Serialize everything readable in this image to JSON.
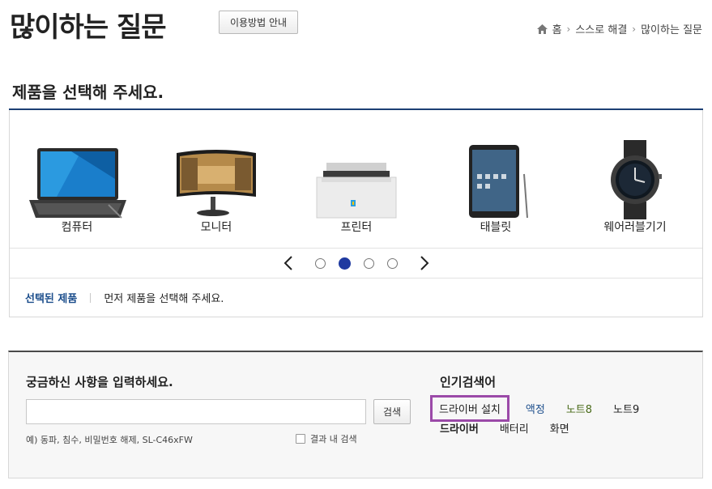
{
  "header": {
    "title": "많이하는 질문",
    "guide_button": "이용방법 안내"
  },
  "breadcrumb": {
    "items": [
      "홈",
      "스스로 해결",
      "많이하는 질문"
    ]
  },
  "section": {
    "title": "제품을 선택해 주세요."
  },
  "products": [
    {
      "label": "컴퓨터",
      "icon": "laptop-icon"
    },
    {
      "label": "모니터",
      "icon": "monitor-icon"
    },
    {
      "label": "프린터",
      "icon": "printer-icon"
    },
    {
      "label": "태블릿",
      "icon": "tablet-icon"
    },
    {
      "label": "웨어러블기기",
      "icon": "smartwatch-icon"
    }
  ],
  "carousel": {
    "page_count": 4,
    "active_page": 2
  },
  "selected": {
    "label": "선택된 제품",
    "text": "먼저 제품을 선택해 주세요."
  },
  "search": {
    "title": "궁금하신 사항을 입력하세요.",
    "input_value": "",
    "button": "검색",
    "example": "예) 동파, 침수, 비밀번호 해제, SL-C46xFW",
    "within_result": "결과 내 검색"
  },
  "popular": {
    "title": "인기검색어",
    "row1": [
      {
        "text": "드라이버 설치",
        "color": "#222222"
      },
      {
        "text": "액정",
        "color": "#1c4e8c"
      },
      {
        "text": "노트8",
        "color": "#4a6b1a"
      },
      {
        "text": "노트9",
        "color": "#222222"
      }
    ],
    "row2": [
      {
        "text": "드라이버",
        "color": "#222222"
      },
      {
        "text": "배터리",
        "color": "#222222"
      },
      {
        "text": "화면",
        "color": "#222222"
      }
    ]
  },
  "colors": {
    "accent": "#1c3f74",
    "dot_active": "#1f3aa0",
    "highlight": "#9b4aa8"
  }
}
